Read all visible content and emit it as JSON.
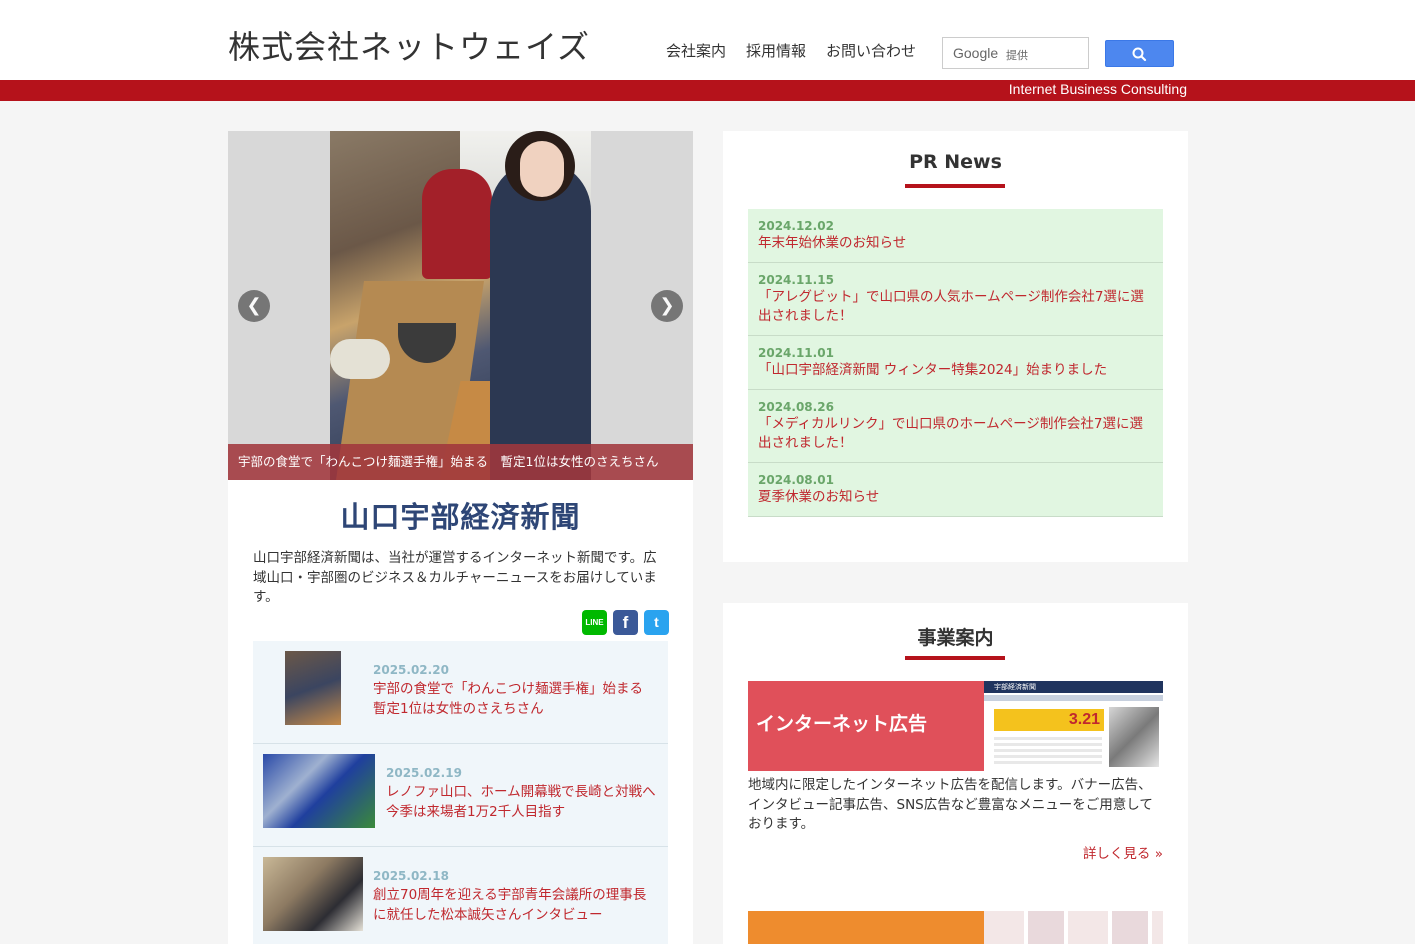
{
  "header": {
    "logo": "株式会社ネットウェイズ",
    "nav": [
      "会社案内",
      "採用情報",
      "お問い合わせ"
    ],
    "search_brand": "Google",
    "search_provided": "提供",
    "tagline": "Internet Business Consulting"
  },
  "slider": {
    "caption": "宇部の食堂で「わんこつけ麺選手権」始まる　暫定1位は女性のさえちさん"
  },
  "newspaper": {
    "title": "山口宇部経済新聞",
    "description": "山口宇部経済新聞は、当社が運営するインターネット新聞です。広域山口・宇部圏のビジネス＆カルチャーニュースをお届けしています。",
    "share": {
      "line": "LINE",
      "facebook": "f",
      "twitter": "t"
    }
  },
  "articles": [
    {
      "date": "2025.02.20",
      "title": "宇部の食堂で「わんこつけ麺選手権」始まる　暫定1位は女性のさえちさん"
    },
    {
      "date": "2025.02.19",
      "title": "レノファ山口、ホーム開幕戦で長崎と対戦へ　今季は来場者1万2千人目指す"
    },
    {
      "date": "2025.02.18",
      "title": "創立70周年を迎える宇部青年会議所の理事長に就任した松本誠矢さんインタビュー"
    }
  ],
  "pr_news": {
    "heading": "PR News",
    "items": [
      {
        "date": "2024.12.02",
        "title": "年末年始休業のお知らせ"
      },
      {
        "date": "2024.11.15",
        "title": "「アレグビット」で山口県の人気ホームページ制作会社7選に選出されました！"
      },
      {
        "date": "2024.11.01",
        "title": "「山口宇部経済新聞 ウィンター特集2024」始まりました"
      },
      {
        "date": "2024.08.26",
        "title": "「メディカルリンク」で山口県のホームページ制作会社7選に選出されました！"
      },
      {
        "date": "2024.08.01",
        "title": "夏季休業のお知らせ"
      }
    ]
  },
  "business": {
    "heading": "事業案内",
    "item1": {
      "label": "インターネット広告",
      "image_masthead": "宇部経済新聞",
      "image_ad": "3.21",
      "description": "地域内に限定したインターネット広告を配信します。バナー広告、インタビュー記事広告、SNS広告など豊富なメニューをご用意しております。",
      "more": "詳しく見る »"
    }
  },
  "colors": {
    "brand_red": "#b5121b",
    "news_bg": "#e1f6e1",
    "article_bg": "#f0f6fa",
    "newspaper_title": "#2e4676"
  }
}
